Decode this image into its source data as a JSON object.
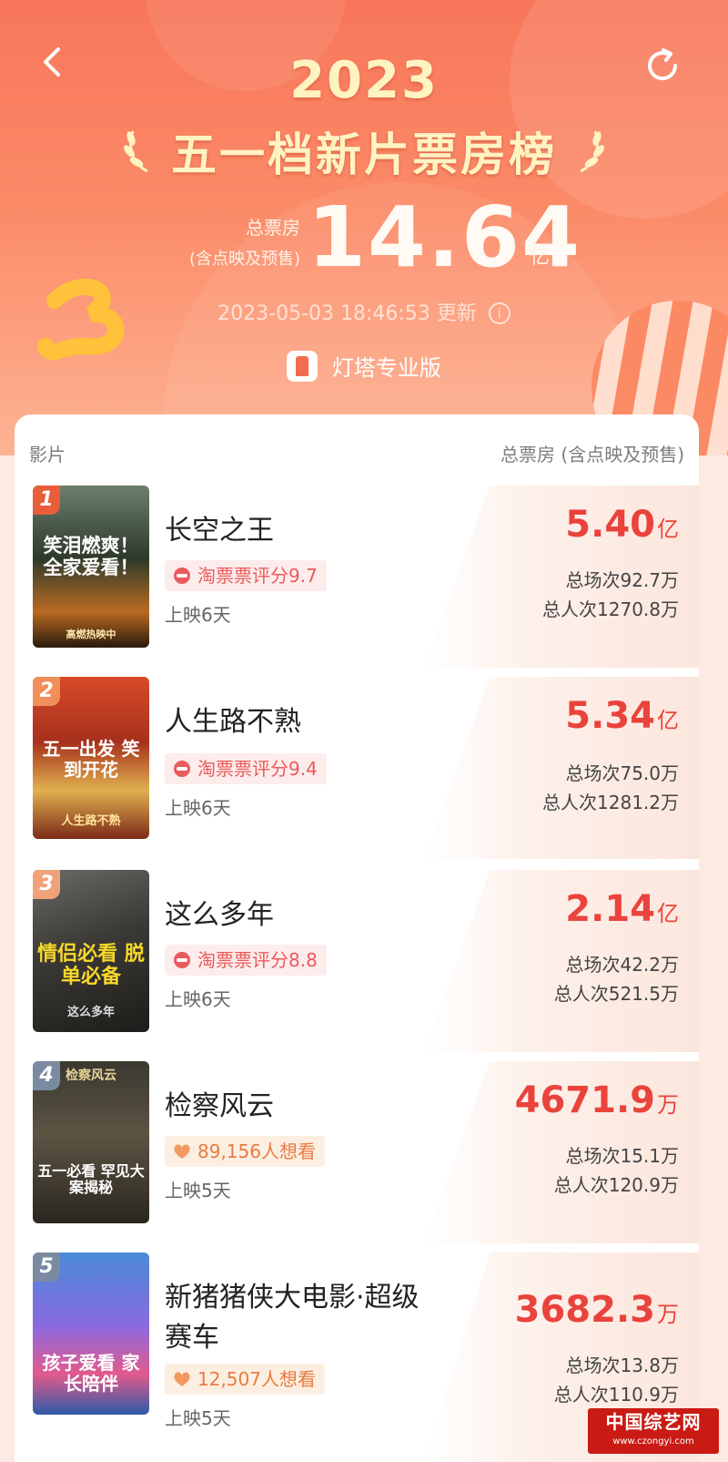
{
  "header": {
    "year": "2023",
    "title": "五一档新片票房榜",
    "total_label_line1": "总票房",
    "total_label_line2": "(含点映及预售)",
    "total_value": "14.64",
    "total_unit": "亿",
    "update_time": "2023-05-03 18:46:53",
    "update_label": "更新",
    "brand": "灯塔专业版",
    "icons": {
      "back": "back-chevron-icon",
      "refresh": "refresh-icon",
      "info": "info-icon"
    },
    "colors": {
      "accent": "#f8765a",
      "title": "#fff3c2"
    }
  },
  "list": {
    "col_left": "影片",
    "col_right": "总票房 (含点映及预售)",
    "colors": {
      "gross": "#e9433c",
      "score_badge": "#ea5b5b",
      "want_badge": "#e87b40"
    },
    "movies": [
      {
        "rank": "1",
        "name": "长空之王",
        "badge_type": "score",
        "badge_text": "淘票票评分9.7",
        "days": "上映6天",
        "gross_value": "5.40",
        "gross_unit": "亿",
        "screenings": "总场次92.7万",
        "admissions": "总人次1270.8万",
        "poster_text": "笑泪燃爽！全家爱看！",
        "poster_sub": "高燃热映中"
      },
      {
        "rank": "2",
        "name": "人生路不熟",
        "badge_type": "score",
        "badge_text": "淘票票评分9.4",
        "days": "上映6天",
        "gross_value": "5.34",
        "gross_unit": "亿",
        "screenings": "总场次75.0万",
        "admissions": "总人次1281.2万",
        "poster_text": "五一出发 笑到开花",
        "poster_sub": "人生路不熟"
      },
      {
        "rank": "3",
        "name": "这么多年",
        "badge_type": "score",
        "badge_text": "淘票票评分8.8",
        "days": "上映6天",
        "gross_value": "2.14",
        "gross_unit": "亿",
        "screenings": "总场次42.2万",
        "admissions": "总人次521.5万",
        "poster_text": "情侣必看 脱单必备",
        "poster_sub": "这么多年"
      },
      {
        "rank": "4",
        "name": "检察风云",
        "badge_type": "want",
        "badge_text": "89,156人想看",
        "days": "上映5天",
        "gross_value": "4671.9",
        "gross_unit": "万",
        "screenings": "总场次15.1万",
        "admissions": "总人次120.9万",
        "poster_text": "五一必看 罕见大案揭秘",
        "poster_sub": "检察风云"
      },
      {
        "rank": "5",
        "name": "新猪猪侠大电影·超级赛车",
        "badge_type": "want",
        "badge_text": "12,507人想看",
        "days": "上映5天",
        "gross_value": "3682.3",
        "gross_unit": "万",
        "screenings": "总场次13.8万",
        "admissions": "总人次110.9万",
        "poster_text": "孩子爱看 家长陪伴",
        "poster_sub": ""
      }
    ]
  },
  "watermark": {
    "line1": "中国综艺网",
    "line2": "www.czongyi.com"
  }
}
